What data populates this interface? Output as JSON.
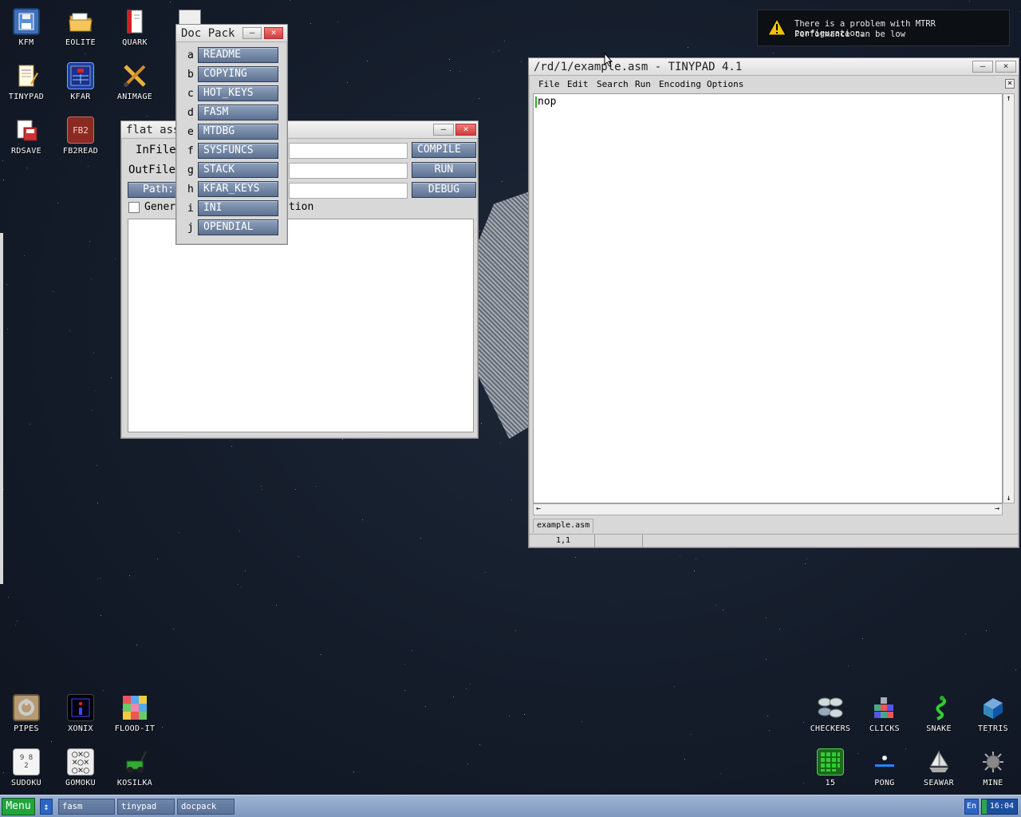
{
  "desktop_icons_left": [
    {
      "label": "KFM",
      "icon": "floppy-icon"
    },
    {
      "label": "EOLITE",
      "icon": "folder-icon"
    },
    {
      "label": "QUARK",
      "icon": "book-icon"
    },
    {
      "label": "TINYPAD",
      "icon": "notepad-icon"
    },
    {
      "label": "KFAR",
      "icon": "kfar-icon"
    },
    {
      "label": "ANIMAGE",
      "icon": "pencil-brush-icon"
    },
    {
      "label": "RDSAVE",
      "icon": "rdsave-icon"
    },
    {
      "label": "FB2READ",
      "icon": "fb2-book-icon"
    }
  ],
  "desktop_icons_bottom_left": [
    {
      "label": "PIPES",
      "icon": "pipes-icon"
    },
    {
      "label": "XONIX",
      "icon": "xonix-icon"
    },
    {
      "label": "FLOOD-IT",
      "icon": "flood-it-icon"
    },
    {
      "label": "SUDOKU",
      "icon": "sudoku-icon"
    },
    {
      "label": "GOMOKU",
      "icon": "gomoku-icon"
    },
    {
      "label": "KOSILKA",
      "icon": "lawnmower-icon"
    }
  ],
  "desktop_icons_bottom_right": [
    {
      "label": "CHECKERS",
      "icon": "checkers-icon"
    },
    {
      "label": "CLICKS",
      "icon": "clicks-icon"
    },
    {
      "label": "SNAKE",
      "icon": "snake-icon"
    },
    {
      "label": "TETRIS",
      "icon": "tetris-icon"
    },
    {
      "label": "15",
      "icon": "fifteen-icon"
    },
    {
      "label": "PONG",
      "icon": "pong-icon"
    },
    {
      "label": "SEAWAR",
      "icon": "ship-icon"
    },
    {
      "label": "MINE",
      "icon": "mine-icon"
    }
  ],
  "notification": {
    "line1": "There is a problem with MTRR configuration.",
    "line2": "Performance can be low"
  },
  "docpack": {
    "title": "Doc Pack",
    "items": [
      {
        "key": "a",
        "label": "README"
      },
      {
        "key": "b",
        "label": "COPYING"
      },
      {
        "key": "c",
        "label": "HOT_KEYS"
      },
      {
        "key": "d",
        "label": "FASM"
      },
      {
        "key": "e",
        "label": "MTDBG"
      },
      {
        "key": "f",
        "label": "SYSFUNCS"
      },
      {
        "key": "g",
        "label": "STACK"
      },
      {
        "key": "h",
        "label": "KFAR_KEYS"
      },
      {
        "key": "i",
        "label": "INI"
      },
      {
        "key": "j",
        "label": "OPENDIAL"
      }
    ]
  },
  "fasm": {
    "title": "flat ass",
    "infile_label": "InFile",
    "outfile_label": "OutFile",
    "path_label": "Path:",
    "compile_label": "COMPILE",
    "run_label": "RUN",
    "debug_label": "DEBUG",
    "checkbox_label_left": "Gener",
    "checkbox_label_right": "tion"
  },
  "tinypad": {
    "title": "/rd/1/example.asm - TINYPAD 4.1",
    "menu": [
      "File",
      "Edit",
      "Search",
      "Run",
      "Encoding",
      "Options"
    ],
    "content": "nop",
    "tab_label": "example.asm",
    "status_position": "1,1"
  },
  "taskbar": {
    "menu_label": "Menu",
    "items": [
      "fasm",
      "tinypad",
      "docpack"
    ],
    "lang": "En",
    "clock": "16:04"
  }
}
